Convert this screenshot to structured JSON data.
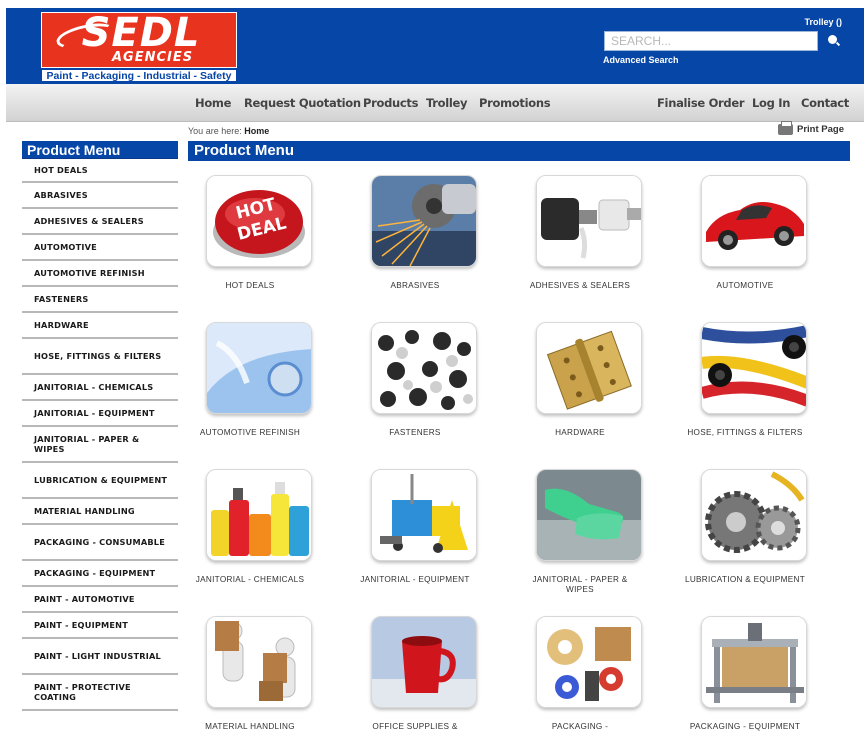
{
  "brand": {
    "name": "SEDL",
    "sub": "AGENCIES",
    "tagline": "Paint - Packaging - Industrial - Safety",
    "red": "#e8331f",
    "blue": "#0646a7"
  },
  "header": {
    "trolley": "Trolley ()",
    "search_placeholder": "SEARCH...",
    "advanced_search": "Advanced Search"
  },
  "nav": {
    "left": [
      "Home",
      "Request Quotation",
      "Products",
      "Trolley",
      "Promotions"
    ],
    "right": [
      "Finalise Order",
      "Log In",
      "Contact"
    ]
  },
  "breadcrumb": {
    "prefix": "You are here:",
    "current": "Home"
  },
  "print_label": "Print Page",
  "sidebar": {
    "title": "Product Menu",
    "items": [
      "HOT DEALS",
      "ABRASIVES",
      "ADHESIVES & SEALERS",
      "AUTOMOTIVE",
      "AUTOMOTIVE REFINISH",
      "FASTENERS",
      "HARDWARE",
      "HOSE, FITTINGS & FILTERS",
      "JANITORIAL - CHEMICALS",
      "JANITORIAL - EQUIPMENT",
      "JANITORIAL - PAPER & WIPES",
      "LUBRICATION & EQUIPMENT",
      "MATERIAL HANDLING",
      "PACKAGING - CONSUMABLE",
      "PACKAGING - EQUIPMENT",
      "PAINT - AUTOMOTIVE",
      "PAINT - EQUIPMENT",
      "PAINT - LIGHT INDUSTRIAL",
      "PAINT - PROTECTIVE COATING"
    ]
  },
  "main": {
    "title": "Product Menu",
    "products": [
      {
        "label": "HOT DEALS",
        "icon": "hot-deal-button"
      },
      {
        "label": "ABRASIVES",
        "icon": "angle-grinder-sparks"
      },
      {
        "label": "ADHESIVES & SEALERS",
        "icon": "glue-tubes"
      },
      {
        "label": "AUTOMOTIVE",
        "icon": "red-sports-car"
      },
      {
        "label": "AUTOMOTIVE REFINISH",
        "icon": "car-paint-refinish"
      },
      {
        "label": "FASTENERS",
        "icon": "fasteners-pile"
      },
      {
        "label": "HARDWARE",
        "icon": "brass-hinge"
      },
      {
        "label": "HOSE, FITTINGS & FILTERS",
        "icon": "coloured-hoses"
      },
      {
        "label": "JANITORIAL - CHEMICALS",
        "icon": "cleaning-bottles"
      },
      {
        "label": "JANITORIAL - EQUIPMENT",
        "icon": "mop-bucket-trolley"
      },
      {
        "label": "JANITORIAL - PAPER & WIPES",
        "icon": "gloved-hand-wiping"
      },
      {
        "label": "LUBRICATION & EQUIPMENT",
        "icon": "gears-oil"
      },
      {
        "label": "MATERIAL HANDLING",
        "icon": "figures-carrying-boxes"
      },
      {
        "label": "OFFICE SUPPLIES &",
        "icon": "red-mug"
      },
      {
        "label": "PACKAGING -",
        "icon": "tape-boxes"
      },
      {
        "label": "PACKAGING - EQUIPMENT",
        "icon": "carton-sealer-machine"
      }
    ]
  }
}
